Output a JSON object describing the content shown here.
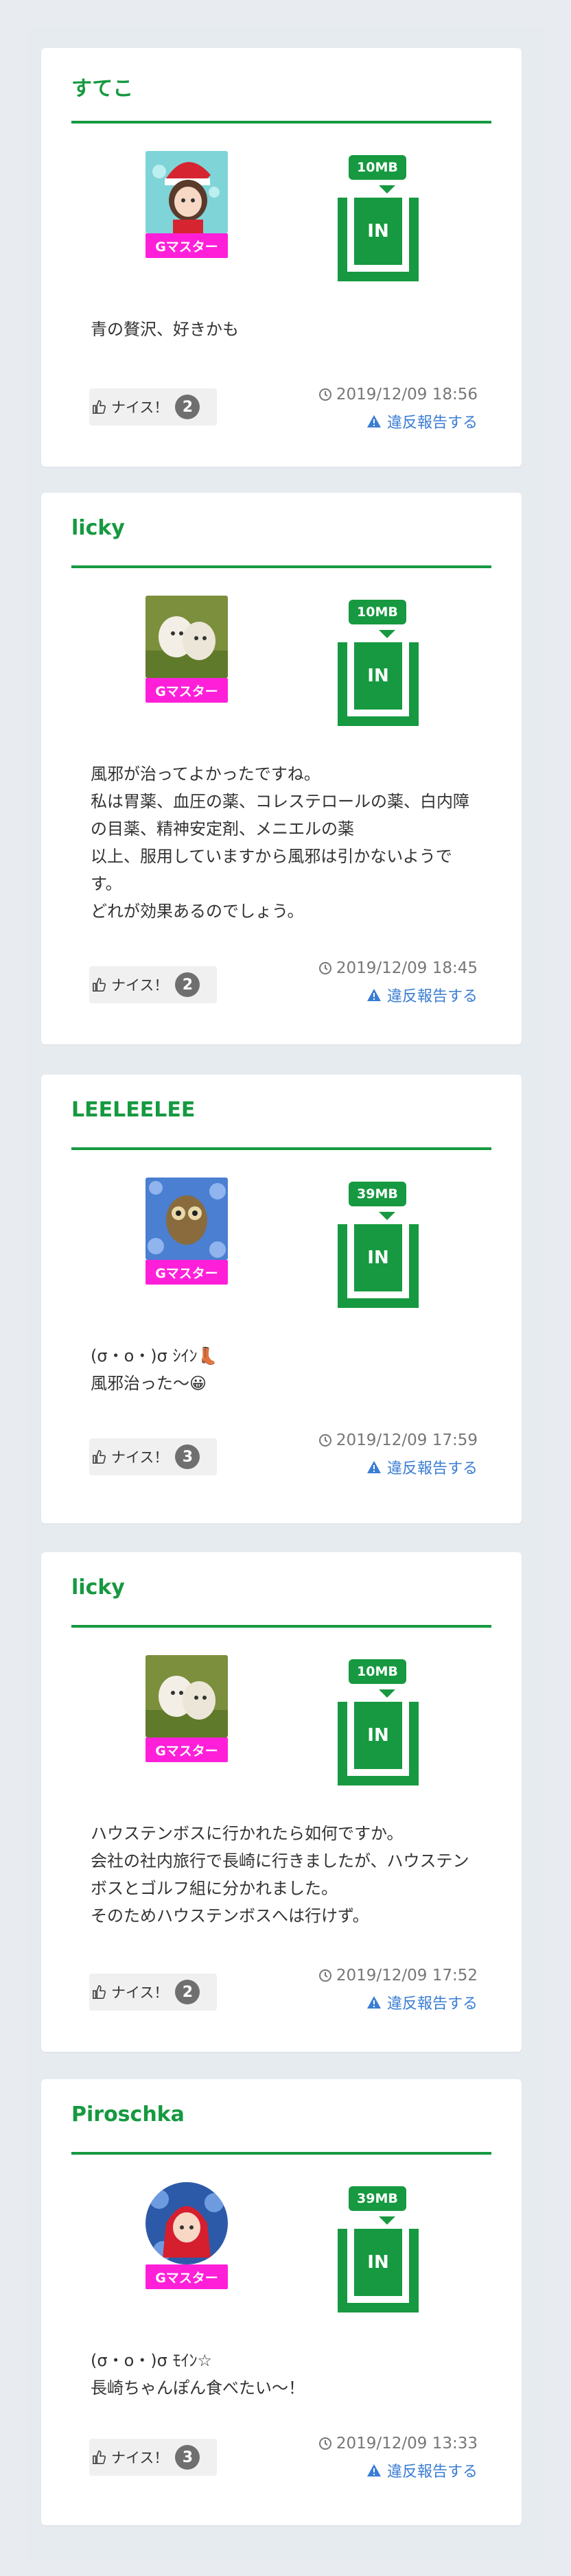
{
  "labels": {
    "badge": "Gマスター",
    "in": "IN",
    "nice": "ナイス！",
    "report": "違反報告する"
  },
  "colors": {
    "brand_green": "#169940",
    "badge_pink": "#ff1fd9",
    "link_blue": "#3a7dd3"
  },
  "posts": [
    {
      "username": "すてこ",
      "avatar": "santa-girl-avatar",
      "data_size": "10MB",
      "message": "青の贅沢、好きかも",
      "nice_count": "2",
      "timestamp": "2019/12/09 18:56"
    },
    {
      "username": "licky",
      "avatar": "white-dogs-avatar",
      "data_size": "10MB",
      "message": "風邪が治ってよかったですね。\n私は胃薬、血圧の薬、コレステロールの薬、白内障の目薬、精神安定剤、メニエルの薬\n以上、服用していますから風邪は引かないようです。\nどれが効果あるのでしょう。",
      "nice_count": "2",
      "timestamp": "2019/12/09 18:45"
    },
    {
      "username": "LEELEELEE",
      "avatar": "owl-flowers-avatar",
      "data_size": "39MB",
      "message": "(σ・o・)σ ｼｲﾝ👢\n風邪治った〜😀",
      "nice_count": "3",
      "timestamp": "2019/12/09 17:59"
    },
    {
      "username": "licky",
      "avatar": "white-dogs-avatar",
      "data_size": "10MB",
      "message": "ハウステンボスに行かれたら如何ですか。\n会社の社内旅行で長崎に行きましたが、ハウステンボスとゴルフ組に分かれました。\nそのためハウステンボスへは行けず。",
      "nice_count": "2",
      "timestamp": "2019/12/09 17:52"
    },
    {
      "username": "Piroschka",
      "avatar": "red-hood-girl-avatar",
      "data_size": "39MB",
      "message": "(σ・o・)σ ﾓｲﾝ☆\n長崎ちゃんぽん食べたい〜！",
      "nice_count": "3",
      "timestamp": "2019/12/09 13:33"
    }
  ]
}
